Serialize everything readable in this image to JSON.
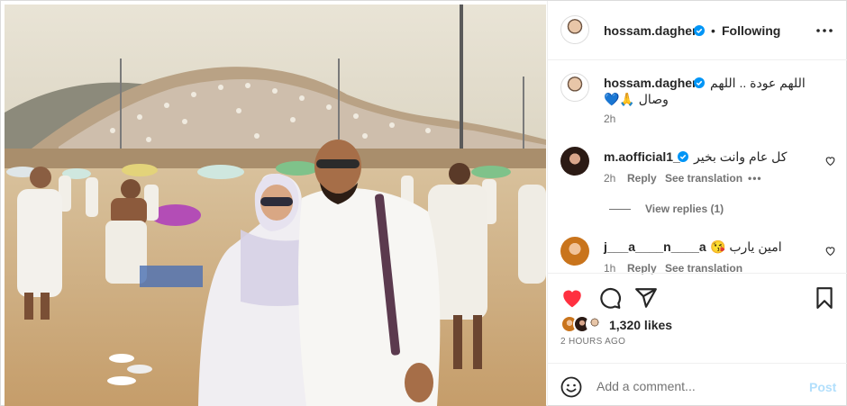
{
  "post": {
    "author": "hossam.dagher",
    "follow_sep": "•",
    "follow_state": "Following",
    "photo_alt_icon": "pilgrimage-photo"
  },
  "caption": {
    "username": "hossam.dagher",
    "line1": "اللهم عودة .. اللهم",
    "line2": "وصال 🙏💙",
    "time": "2h"
  },
  "comments": [
    {
      "username": "m.aofficial1_",
      "text": "كل عام وانت بخير",
      "time": "2h",
      "reply": "Reply",
      "translate": "See translation",
      "more": "•••"
    },
    {
      "username": "j___a____n____a",
      "text": "امين يارب 😘",
      "time": "1h",
      "reply": "Reply",
      "translate": "See translation"
    }
  ],
  "view_replies": "View replies (1)",
  "likes": "1,320 likes",
  "time_ago": "2 HOURS AGO",
  "comment_box": {
    "placeholder": "Add a comment...",
    "post_label": "Post"
  },
  "colors": {
    "heart": "#ff3040",
    "verified": "#0095f6",
    "post_disabled": "#b2dffc"
  }
}
